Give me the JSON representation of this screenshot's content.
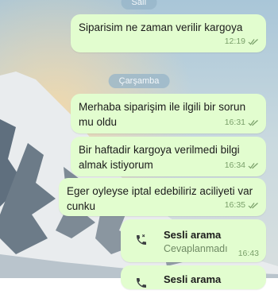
{
  "day_labels": {
    "top_partial": "Salı",
    "wednesday": "Çarşamba"
  },
  "messages": [
    {
      "text": "Siparisim ne zaman verilir kargoya",
      "time": "12:19"
    },
    {
      "text": "Merhaba siparişim ile ilgili bir sorun mu oldu",
      "time": "16:31"
    },
    {
      "text": "Bir haftadir kargoya verilmedi bilgi almak istiyorum",
      "time": "16:34"
    },
    {
      "text": "Eger oyleyse iptal edebiliriz aciliyeti var cunku",
      "time": "16:35"
    }
  ],
  "call": {
    "title": "Sesli arama",
    "status": "Cevaplanmadı",
    "time": "16:43",
    "icon": "phone-icon"
  },
  "partial_call": {
    "title": "Sesli arama"
  },
  "colors": {
    "bubble": "#e2fdcf",
    "check": "#7aa06a",
    "pill": "#96b4c8"
  }
}
